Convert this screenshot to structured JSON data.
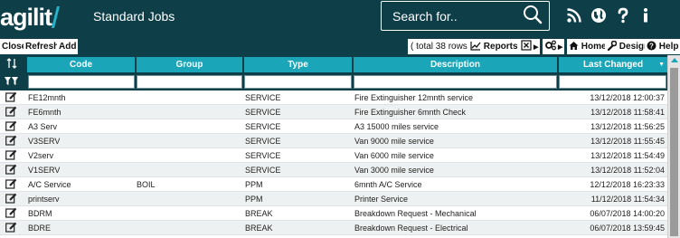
{
  "app": {
    "logo_text": "agilit",
    "page_title": "Standard Jobs"
  },
  "search": {
    "placeholder": "Search for.."
  },
  "header_icons": [
    "rss-icon",
    "globe-icon",
    "help-icon",
    "info-icon"
  ],
  "toolbar": {
    "close_label": "Close",
    "refresh_label": "Refresh",
    "add_label": "Add",
    "rows_info": "( total 38 rows )",
    "reports_label": "Reports",
    "home_label": "Home",
    "design_label": "Design",
    "help_label": "Help"
  },
  "columns": {
    "code": "Code",
    "group": "Group",
    "type": "Type",
    "description": "Description",
    "last_changed": "Last Changed"
  },
  "rows": [
    {
      "code": "FE12mnth",
      "group": "",
      "type": "SERVICE",
      "description": "Fire Extinguisher 12mnth service",
      "last_changed": "13/12/2018 12:00:37"
    },
    {
      "code": "FE6mnth",
      "group": "",
      "type": "SERVICE",
      "description": "Fire Extinguisher 6mnth Check",
      "last_changed": "13/12/2018 11:58:41"
    },
    {
      "code": "A3 Serv",
      "group": "",
      "type": "SERVICE",
      "description": "A3 15000 miles service",
      "last_changed": "13/12/2018 11:56:25"
    },
    {
      "code": "V3SERV",
      "group": "",
      "type": "SERVICE",
      "description": "Van 9000 mile service",
      "last_changed": "13/12/2018 11:55:45"
    },
    {
      "code": "V2serv",
      "group": "",
      "type": "SERVICE",
      "description": "Van 6000 mile service",
      "last_changed": "13/12/2018 11:54:49"
    },
    {
      "code": "V1SERV",
      "group": "",
      "type": "SERVICE",
      "description": "Van 3000 mile service",
      "last_changed": "13/12/2018 11:52:04"
    },
    {
      "code": "A/C Service",
      "group": "BOIL",
      "type": "PPM",
      "description": "6mnth A/C Service",
      "last_changed": "12/12/2018 16:23:33"
    },
    {
      "code": "printserv",
      "group": "",
      "type": "PPM",
      "description": "Printer Service",
      "last_changed": "11/12/2018 11:54:34"
    },
    {
      "code": "BDRM",
      "group": "",
      "type": "BREAK",
      "description": "Breakdown Request - Mechanical",
      "last_changed": "06/07/2018 14:00:20"
    },
    {
      "code": "BDRE",
      "group": "",
      "type": "BREAK",
      "description": "Breakdown Request - Electrical",
      "last_changed": "06/07/2018 13:59:45"
    }
  ],
  "colors": {
    "header_bg": "#0e3e48",
    "accent": "#1aa5b8",
    "row_alt": "#eef1f1"
  }
}
